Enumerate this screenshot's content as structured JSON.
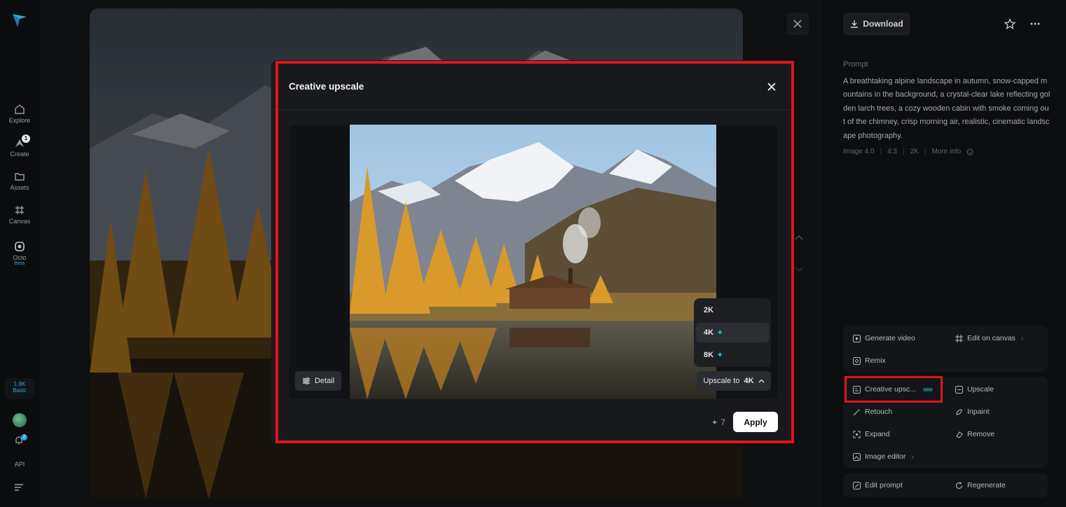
{
  "sidebar": {
    "nav": [
      {
        "label": "Explore",
        "icon": "home-icon"
      },
      {
        "label": "Create",
        "icon": "create-icon",
        "badge": "1"
      },
      {
        "label": "Assets",
        "icon": "folder-icon"
      },
      {
        "label": "Canvas",
        "icon": "canvas-icon"
      },
      {
        "label": "Octo",
        "icon": "octo-icon",
        "tag": "Beta"
      }
    ],
    "credits": {
      "amount": "1.9K",
      "plan": "Basic"
    },
    "notifications": "2",
    "api_label": "API"
  },
  "header": {
    "download_label": "Download"
  },
  "prompt": {
    "label": "Prompt",
    "text": "A breathtaking alpine landscape in autumn, snow-capped mountains in the background, a crystal-clear lake reflecting golden larch trees, a cozy wooden cabin with smoke coming out of the chimney, crisp morning air, realistic, cinematic landscape photography.",
    "meta": [
      "Image 4.0",
      "4:3",
      "2K"
    ],
    "more_info": "More info"
  },
  "actions": {
    "group1": [
      "Generate video",
      "Edit on canvas",
      "Remix"
    ],
    "group2": [
      "Creative upsc...",
      "Upscale",
      "Retouch",
      "Inpaint",
      "Expand",
      "Remove",
      "Image editor"
    ],
    "group3": [
      "Edit prompt",
      "Regenerate"
    ]
  },
  "modal": {
    "title": "Creative upscale",
    "detail_label": "Detail",
    "resolutions": [
      {
        "label": "2K",
        "premium": false
      },
      {
        "label": "4K",
        "premium": true
      },
      {
        "label": "8K",
        "premium": true
      }
    ],
    "selected_resolution": "4K",
    "upscale_to_label": "Upscale to",
    "cost": "7",
    "apply_label": "Apply"
  },
  "colors": {
    "accent": "#25b9e6",
    "highlight": "#e0141e"
  }
}
